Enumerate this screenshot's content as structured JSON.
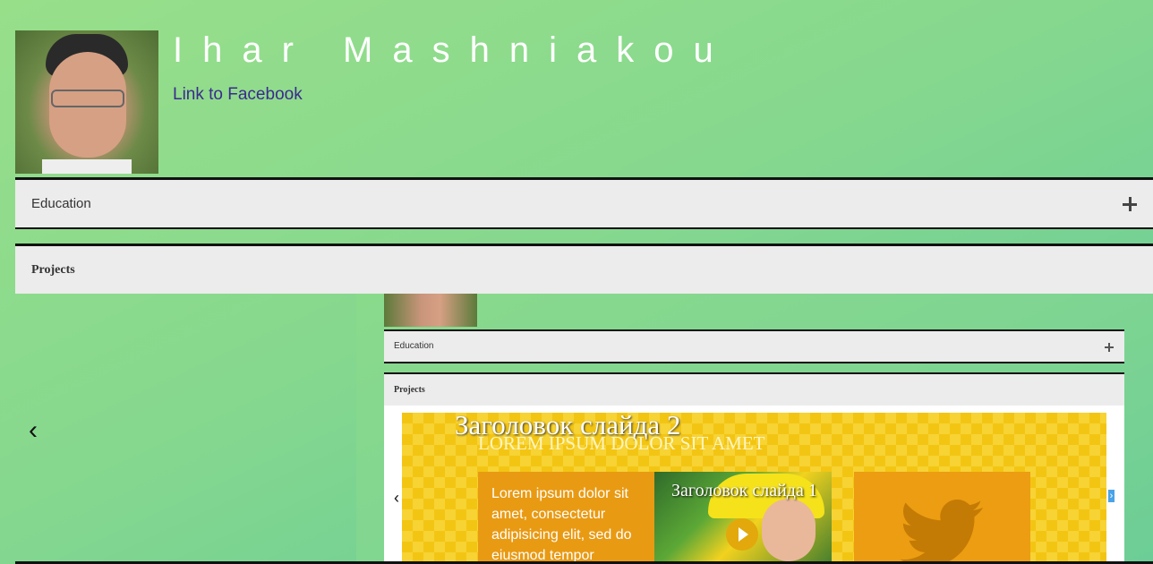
{
  "profile": {
    "name": "Ihar Mashniakou",
    "facebook_link": "Link to Facebook"
  },
  "sections": {
    "education": "Education",
    "projects": "Projects"
  },
  "slider": {
    "prev": "‹",
    "next": "›"
  },
  "preview": {
    "education": "Education",
    "projects": "Projects",
    "prev": "‹",
    "next": "›",
    "slide_title": "Заголовок слайда 2",
    "slide_subtitle": "LOREM IPSUM DOLOR SIT AMET",
    "card_text": "Lorem ipsum dolor sit amet, consectetur adipisicing elit, sed do eiusmod tempor",
    "card_image_title": "Заголовок слайда 1"
  },
  "colors": {
    "background_start": "#98df8a",
    "background_end": "#62c99a",
    "name": "#ffffff",
    "link": "#3b2a8f",
    "accordion_bg": "#ececec",
    "slide_yellow": "#f3c513",
    "card_orange": "#e99a13"
  }
}
